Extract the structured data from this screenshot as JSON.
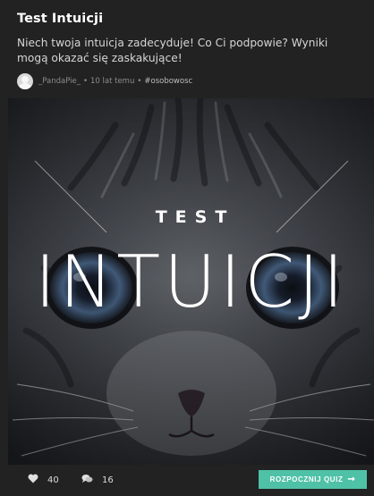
{
  "quiz": {
    "title": "Test Intuicji",
    "description": "Niech twoja intuicja zadecyduje! Co Ci podpowie? Wyniki mogą okazać się zaskakujące!",
    "author": "_PandaPie_",
    "time_ago": "10 lat temu",
    "tag": "#osobowosc",
    "meta_separator": "•"
  },
  "hero": {
    "line_small": "TEST",
    "line_big": "INTUICJI",
    "image_subject": "kitten-face"
  },
  "footer": {
    "likes": "40",
    "comments": "16",
    "start_label": "ROZPOCZNIJ QUIZ",
    "start_arrow": "➞"
  },
  "colors": {
    "background": "#222222",
    "accent": "#4fc1a7",
    "text": "#ffffff",
    "muted": "#8c8c8c"
  },
  "icons": {
    "likes": "heart-icon",
    "comments": "comments-icon",
    "author": "avatar-placeholder-icon",
    "start": "arrow-right-icon"
  }
}
